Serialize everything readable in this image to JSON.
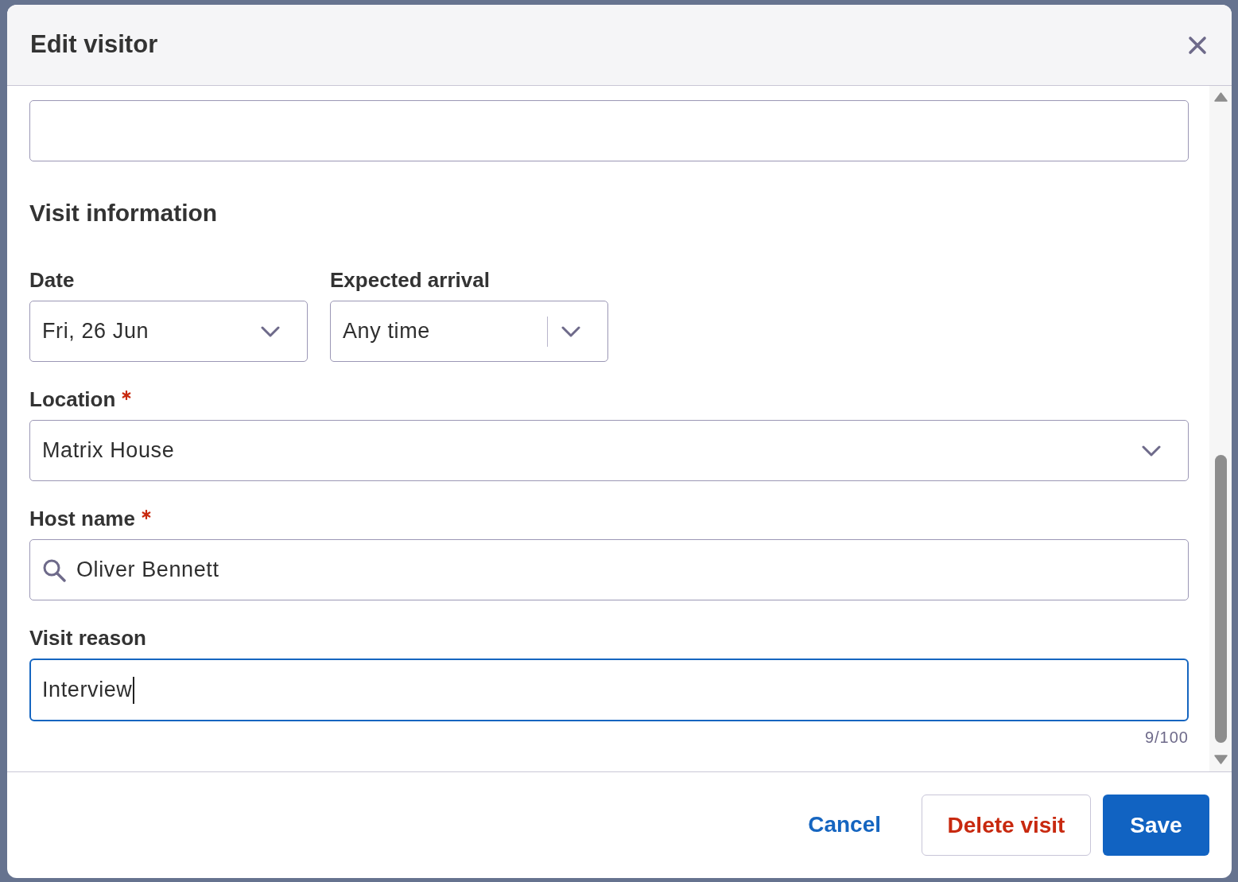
{
  "dialog": {
    "title": "Edit visitor"
  },
  "top_fields": [
    {
      "focused": false
    }
  ],
  "section": {
    "title": "Visit information",
    "rows": [
      {
        "fields": [
          {
            "kind": "select",
            "label": "Date",
            "required": false,
            "value": "Fri, 26 Jun",
            "focused": false
          },
          {
            "kind": "combo",
            "label": "Expected arrival",
            "required": false,
            "value": "Any time",
            "focused": false
          }
        ]
      },
      {
        "fields": [
          {
            "kind": "select",
            "label": "Location",
            "required": true,
            "value": "Matrix House",
            "focused": false
          }
        ]
      },
      {
        "fields": [
          {
            "kind": "search",
            "label": "Host name",
            "required": true,
            "value": "Oliver Bennett",
            "focused": false
          }
        ]
      },
      {
        "fields": [
          {
            "kind": "text",
            "label": "Visit reason",
            "required": false,
            "value": "Interview",
            "focused": true,
            "counter": "9/100"
          }
        ]
      }
    ]
  },
  "footer": {
    "buttons": [
      {
        "kind": "link",
        "label": "Cancel"
      },
      {
        "kind": "danger",
        "label": "Delete visit"
      },
      {
        "kind": "primary",
        "label": "Save"
      }
    ]
  }
}
